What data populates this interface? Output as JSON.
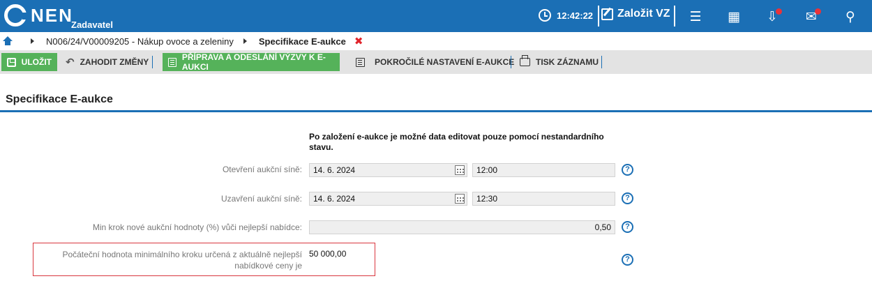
{
  "header": {
    "logo": "NEN",
    "subtitle": "Zadavatel",
    "time": "12:42:22",
    "new_vz": "Založit VZ",
    "icons": [
      "clock-icon",
      "menu-icon",
      "calculator-icon",
      "inbox-icon",
      "mail-icon",
      "user-icon"
    ],
    "notification_color": "#e8333a",
    "brand_color": "#1b6fb5"
  },
  "breadcrumb": {
    "items": [
      "N006/24/V00009205 - Nákup ovoce a zeleniny",
      "Specifikace E-aukce"
    ],
    "close": "✖"
  },
  "toolbar": {
    "save": "ULOŽIT",
    "discard": "ZAHODIT ZMĚNY",
    "prepare": "PŘÍPRAVA A ODESLÁNÍ VÝZVY K E-AUKCI",
    "advanced": "POKROČILÉ NASTAVENÍ E-AUKCE",
    "print": "TISK ZÁZNAMU"
  },
  "section": {
    "title": "Specifikace E-aukce"
  },
  "form": {
    "note": "Po založení e-aukce je možné data editovat pouze pomocí nestandardního stavu.",
    "open_label": "Otevření aukční síně:",
    "open_date": "14. 6. 2024",
    "open_time": "12:00",
    "close_label": "Uzavření aukční síně:",
    "close_date": "14. 6. 2024",
    "close_time": "12:30",
    "min_step_label": "Min krok nové aukční hodnoty (%) vůči nejlepší nabídce:",
    "min_step_value": "0,50",
    "initial_label": "Počáteční hodnota minimálního kroku určená z aktuálně nejlepší nabídkové ceny je",
    "initial_value": "50 000,00",
    "help": "?"
  }
}
